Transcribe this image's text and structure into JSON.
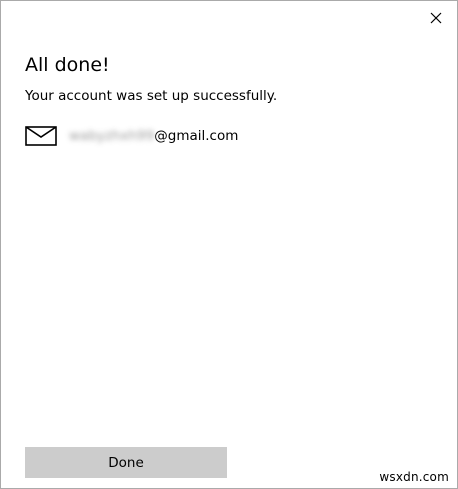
{
  "dialog": {
    "title": "All done!",
    "message": "Your account was set up successfully.",
    "close_icon": "close-icon"
  },
  "account": {
    "icon": "mail-icon",
    "email_user_redacted": "wabyzhxh99",
    "email_domain": "@gmail.com"
  },
  "actions": {
    "done_label": "Done",
    "done_button_color": "#cccccc"
  },
  "watermark": {
    "text": "wsxdn.com"
  }
}
